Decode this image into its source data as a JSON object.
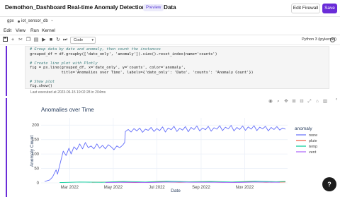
{
  "header": {
    "title": "Demothon_Dashboard Real-time Anomaly Detection in IoT Data",
    "badge": "Preview",
    "edit_firewall_label": "Edit Firewall",
    "save_label": "Save"
  },
  "env": {
    "label": "gpx",
    "database": "iot_sensor_db"
  },
  "menu": [
    "Edit",
    "View",
    "Run",
    "Kernel"
  ],
  "toolbar": {
    "cell_type": "Code",
    "kernel": "Python 3 (ipykernel)"
  },
  "cell": {
    "lines": [
      {
        "kind": "comment",
        "text": "# Group data by date and anomaly, then count the instances"
      },
      {
        "kind": "code",
        "text": "grouped_df = df.groupby(['date_only', 'anomaly']).size().reset_index(name='counts')"
      },
      {
        "kind": "blank",
        "text": ""
      },
      {
        "kind": "comment",
        "text": "# Create line plot with Plotly"
      },
      {
        "kind": "code",
        "text": "fig = px.line(grouped_df, x='date_only', y='counts', color='anomaly',"
      },
      {
        "kind": "code",
        "text": "              title='Anomalies over Time', labels={'date_only': 'Date', 'counts': 'Anomaly Count'})"
      },
      {
        "kind": "blank",
        "text": ""
      },
      {
        "kind": "comment",
        "text": "# Show plot"
      },
      {
        "kind": "code",
        "text": "fig.show()"
      }
    ],
    "exec_info": "Last executed at 2023-06-15 19:02:28 in 204ms"
  },
  "colors": {
    "accent": "#6a2cd8",
    "none": "#636efa",
    "pluie": "#ef553b",
    "temp": "#00cc96",
    "vent": "#ab63fa"
  },
  "icons": [
    "save-icon",
    "add-icon",
    "cut-icon",
    "copy-icon",
    "paste-icon",
    "run-icon",
    "stop-icon",
    "restart-icon",
    "fast-forward-icon"
  ],
  "chart_data": {
    "type": "line",
    "title": "Anomalies over Time",
    "xlabel": "Date",
    "ylabel": "Anomaly Count",
    "x_ticks": [
      "Mar 2022",
      "May 2022",
      "Jul 2022",
      "Sep 2022",
      "Nov 2022"
    ],
    "y_ticks": [
      0,
      50,
      100,
      150,
      200
    ],
    "ylim": [
      0,
      225
    ],
    "xlim": [
      "2022-01-20",
      "2022-12-31"
    ],
    "grid": true,
    "legend": {
      "title": "anomaly",
      "placement": "right"
    },
    "series": [
      {
        "name": "none",
        "color": "#636efa",
        "points": [
          [
            "2022-01-25",
            5
          ],
          [
            "2022-02-01",
            10
          ],
          [
            "2022-02-05",
            20
          ],
          [
            "2022-02-10",
            45
          ],
          [
            "2022-02-12",
            30
          ],
          [
            "2022-02-16",
            70
          ],
          [
            "2022-02-20",
            110
          ],
          [
            "2022-02-24",
            95
          ],
          [
            "2022-02-28",
            120
          ],
          [
            "2022-03-03",
            100
          ],
          [
            "2022-03-07",
            125
          ],
          [
            "2022-03-11",
            115
          ],
          [
            "2022-03-15",
            135
          ],
          [
            "2022-03-19",
            118
          ],
          [
            "2022-03-23",
            140
          ],
          [
            "2022-03-27",
            122
          ],
          [
            "2022-03-31",
            128
          ],
          [
            "2022-04-04",
            118
          ],
          [
            "2022-04-08",
            135
          ],
          [
            "2022-04-12",
            120
          ],
          [
            "2022-04-16",
            130
          ],
          [
            "2022-04-20",
            118
          ],
          [
            "2022-04-24",
            132
          ],
          [
            "2022-04-28",
            125
          ],
          [
            "2022-05-02",
            115
          ],
          [
            "2022-05-06",
            128
          ],
          [
            "2022-05-10",
            122
          ],
          [
            "2022-05-14",
            130
          ],
          [
            "2022-05-17",
            140
          ],
          [
            "2022-05-18",
            178
          ],
          [
            "2022-05-22",
            185
          ],
          [
            "2022-05-26",
            176
          ],
          [
            "2022-05-30",
            188
          ],
          [
            "2022-06-03",
            180
          ],
          [
            "2022-06-07",
            190
          ],
          [
            "2022-06-11",
            175
          ],
          [
            "2022-06-15",
            186
          ],
          [
            "2022-06-19",
            182
          ],
          [
            "2022-06-23",
            192
          ],
          [
            "2022-06-27",
            178
          ],
          [
            "2022-07-01",
            188
          ],
          [
            "2022-07-05",
            181
          ],
          [
            "2022-07-09",
            194
          ],
          [
            "2022-07-13",
            176
          ],
          [
            "2022-07-17",
            190
          ],
          [
            "2022-07-21",
            184
          ],
          [
            "2022-07-25",
            196
          ],
          [
            "2022-07-29",
            178
          ],
          [
            "2022-08-02",
            189
          ],
          [
            "2022-08-06",
            183
          ],
          [
            "2022-08-10",
            195
          ],
          [
            "2022-08-14",
            177
          ],
          [
            "2022-08-18",
            192
          ],
          [
            "2022-08-22",
            185
          ],
          [
            "2022-08-26",
            197
          ],
          [
            "2022-08-30",
            180
          ],
          [
            "2022-09-03",
            190
          ],
          [
            "2022-09-07",
            184
          ],
          [
            "2022-09-11",
            196
          ],
          [
            "2022-09-15",
            179
          ],
          [
            "2022-09-19",
            191
          ],
          [
            "2022-09-23",
            186
          ],
          [
            "2022-09-27",
            198
          ],
          [
            "2022-10-01",
            181
          ],
          [
            "2022-10-05",
            193
          ],
          [
            "2022-10-09",
            187
          ],
          [
            "2022-10-13",
            199
          ],
          [
            "2022-10-17",
            180
          ],
          [
            "2022-10-21",
            192
          ],
          [
            "2022-10-25",
            185
          ],
          [
            "2022-10-29",
            197
          ],
          [
            "2022-11-02",
            182
          ],
          [
            "2022-11-06",
            194
          ],
          [
            "2022-11-10",
            186
          ],
          [
            "2022-11-14",
            198
          ],
          [
            "2022-11-18",
            181
          ],
          [
            "2022-11-22",
            193
          ],
          [
            "2022-11-26",
            187
          ],
          [
            "2022-11-30",
            196
          ],
          [
            "2022-12-04",
            180
          ],
          [
            "2022-12-08",
            192
          ],
          [
            "2022-12-12",
            185
          ],
          [
            "2022-12-16",
            195
          ],
          [
            "2022-12-20",
            183
          ],
          [
            "2022-12-24",
            190
          ],
          [
            "2022-12-28",
            186
          ]
        ]
      },
      {
        "name": "pluie",
        "color": "#ef553b",
        "points": [
          [
            "2022-04-01",
            2
          ],
          [
            "2022-05-01",
            3
          ],
          [
            "2022-06-01",
            1
          ],
          [
            "2022-07-01",
            4
          ],
          [
            "2022-08-01",
            2
          ],
          [
            "2022-09-01",
            3
          ],
          [
            "2022-10-01",
            2
          ],
          [
            "2022-11-01",
            4
          ],
          [
            "2022-12-01",
            2
          ],
          [
            "2022-12-28",
            3
          ]
        ]
      },
      {
        "name": "temp",
        "color": "#00cc96",
        "points": [
          [
            "2022-02-15",
            1
          ],
          [
            "2022-03-15",
            3
          ],
          [
            "2022-04-15",
            2
          ],
          [
            "2022-05-15",
            5
          ],
          [
            "2022-06-15",
            3
          ],
          [
            "2022-07-15",
            6
          ],
          [
            "2022-08-15",
            4
          ],
          [
            "2022-09-15",
            5
          ],
          [
            "2022-10-15",
            3
          ],
          [
            "2022-11-15",
            6
          ],
          [
            "2022-12-15",
            4
          ],
          [
            "2022-12-28",
            5
          ]
        ]
      },
      {
        "name": "vent",
        "color": "#ab63fa",
        "points": [
          [
            "2022-04-20",
            1
          ],
          [
            "2022-05-20",
            2
          ],
          [
            "2022-06-20",
            1
          ],
          [
            "2022-07-20",
            3
          ],
          [
            "2022-08-20",
            2
          ],
          [
            "2022-09-20",
            2
          ],
          [
            "2022-10-20",
            1
          ],
          [
            "2022-11-20",
            3
          ],
          [
            "2022-12-20",
            2
          ]
        ]
      }
    ]
  }
}
